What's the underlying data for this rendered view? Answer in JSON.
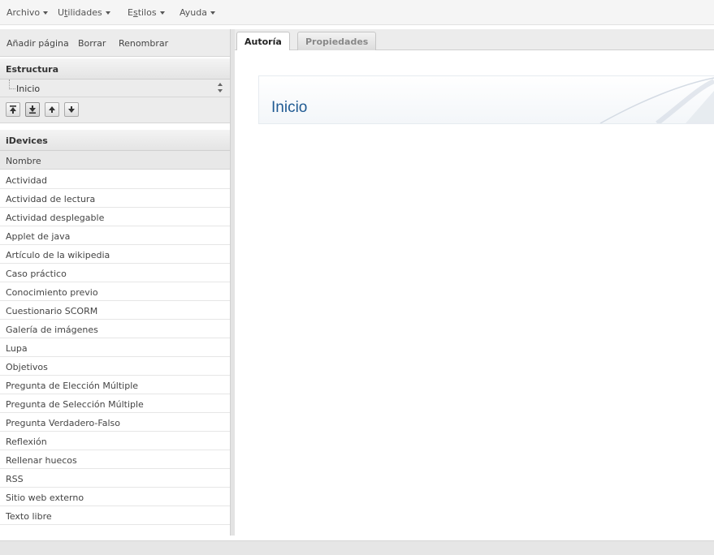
{
  "menubar": {
    "items": [
      {
        "label": "Archivo",
        "underline": ""
      },
      {
        "pre": "U",
        "u": "t",
        "post": "ilidades"
      },
      {
        "pre": "E",
        "u": "s",
        "post": "tilos"
      },
      {
        "label": "Ayuda"
      }
    ]
  },
  "left_panel": {
    "toolbar": {
      "add_page": "Añadir página",
      "delete": "Borrar",
      "rename": "Renombrar"
    },
    "structure": {
      "heading": "Estructura",
      "selected_node": "Inicio"
    },
    "move_buttons": [
      "move-to-top",
      "move-up-level",
      "move-up",
      "move-down"
    ],
    "idevices": {
      "heading": "iDevices",
      "column_header": "Nombre",
      "items": [
        "Actividad",
        "Actividad de lectura",
        "Actividad desplegable",
        "Applet de java",
        "Artículo de la wikipedia",
        "Caso práctico",
        "Conocimiento previo",
        "Cuestionario SCORM",
        "Galería de imágenes",
        "Lupa",
        "Objetivos",
        "Pregunta de Elección Múltiple",
        "Pregunta de Selección Múltiple",
        "Pregunta Verdadero-Falso",
        "Reflexión",
        "Rellenar huecos",
        "RSS",
        "Sitio web externo",
        "Texto libre"
      ]
    }
  },
  "tabs": {
    "authoring": "Autoría",
    "properties": "Propiedades",
    "active": "authoring"
  },
  "content": {
    "page_title": "Inicio"
  },
  "colors": {
    "title": "#1f5a92",
    "panel_bg": "#ececec",
    "header_bg": "#e4e4e4"
  }
}
